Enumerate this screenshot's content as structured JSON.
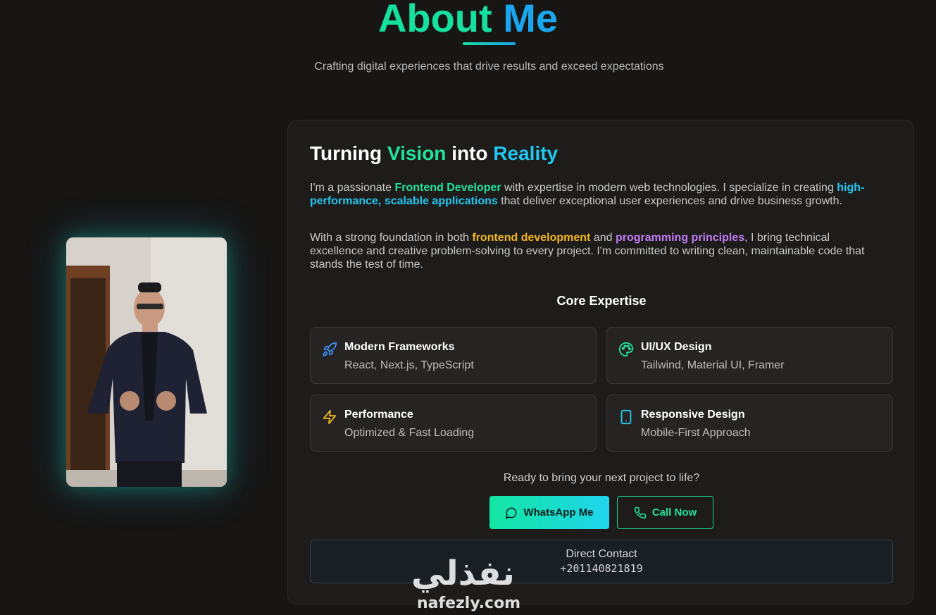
{
  "header": {
    "title_part1": "About",
    "title_part2": "Me",
    "subtitle": "Crafting digital experiences that drive results and exceed expectations"
  },
  "card": {
    "title_part1": "Turning",
    "title_hl1": "Vision",
    "title_part2": "into",
    "title_hl2": "Reality",
    "paragraph1": {
      "t1": "I'm a passionate ",
      "h1": "Frontend Developer",
      "t2": " with expertise in modern web technologies. I specialize in creating ",
      "h2": "high-performance, scalable applications",
      "t3": " that deliver exceptional user experiences and drive business growth."
    },
    "paragraph2": {
      "t1": "With a strong foundation in both ",
      "h1": "frontend development",
      "t2": " and ",
      "h2": "programming principles",
      "t3": ", I bring technical excellence and creative problem-solving to every project. I'm committed to writing clean, maintainable code that stands the test of time."
    },
    "core_title": "Core Expertise",
    "expertise": [
      {
        "title": "Modern Frameworks",
        "subtitle": "React, Next.js, TypeScript",
        "icon": "rocket-icon",
        "color": "#3b8cf0"
      },
      {
        "title": "UI/UX Design",
        "subtitle": "Tailwind, Material UI, Framer",
        "icon": "palette-icon",
        "color": "#22e39a"
      },
      {
        "title": "Performance",
        "subtitle": "Optimized & Fast Loading",
        "icon": "lightning-icon",
        "color": "#f5b81c"
      },
      {
        "title": "Responsive Design",
        "subtitle": "Mobile-First Approach",
        "icon": "mobile-icon",
        "color": "#22c7f0"
      }
    ],
    "cta_text": "Ready to bring your next project to life?",
    "whatsapp_label": "WhatsApp Me",
    "call_label": "Call Now",
    "contact_label": "Direct Contact",
    "contact_phone": "+201140821819"
  },
  "watermark": {
    "arabic": "نفذلي",
    "latin": "nafezly.com"
  },
  "colors": {
    "accent_green": "#16e0a0",
    "accent_blue": "#1aa6ee",
    "background": "#171615"
  }
}
